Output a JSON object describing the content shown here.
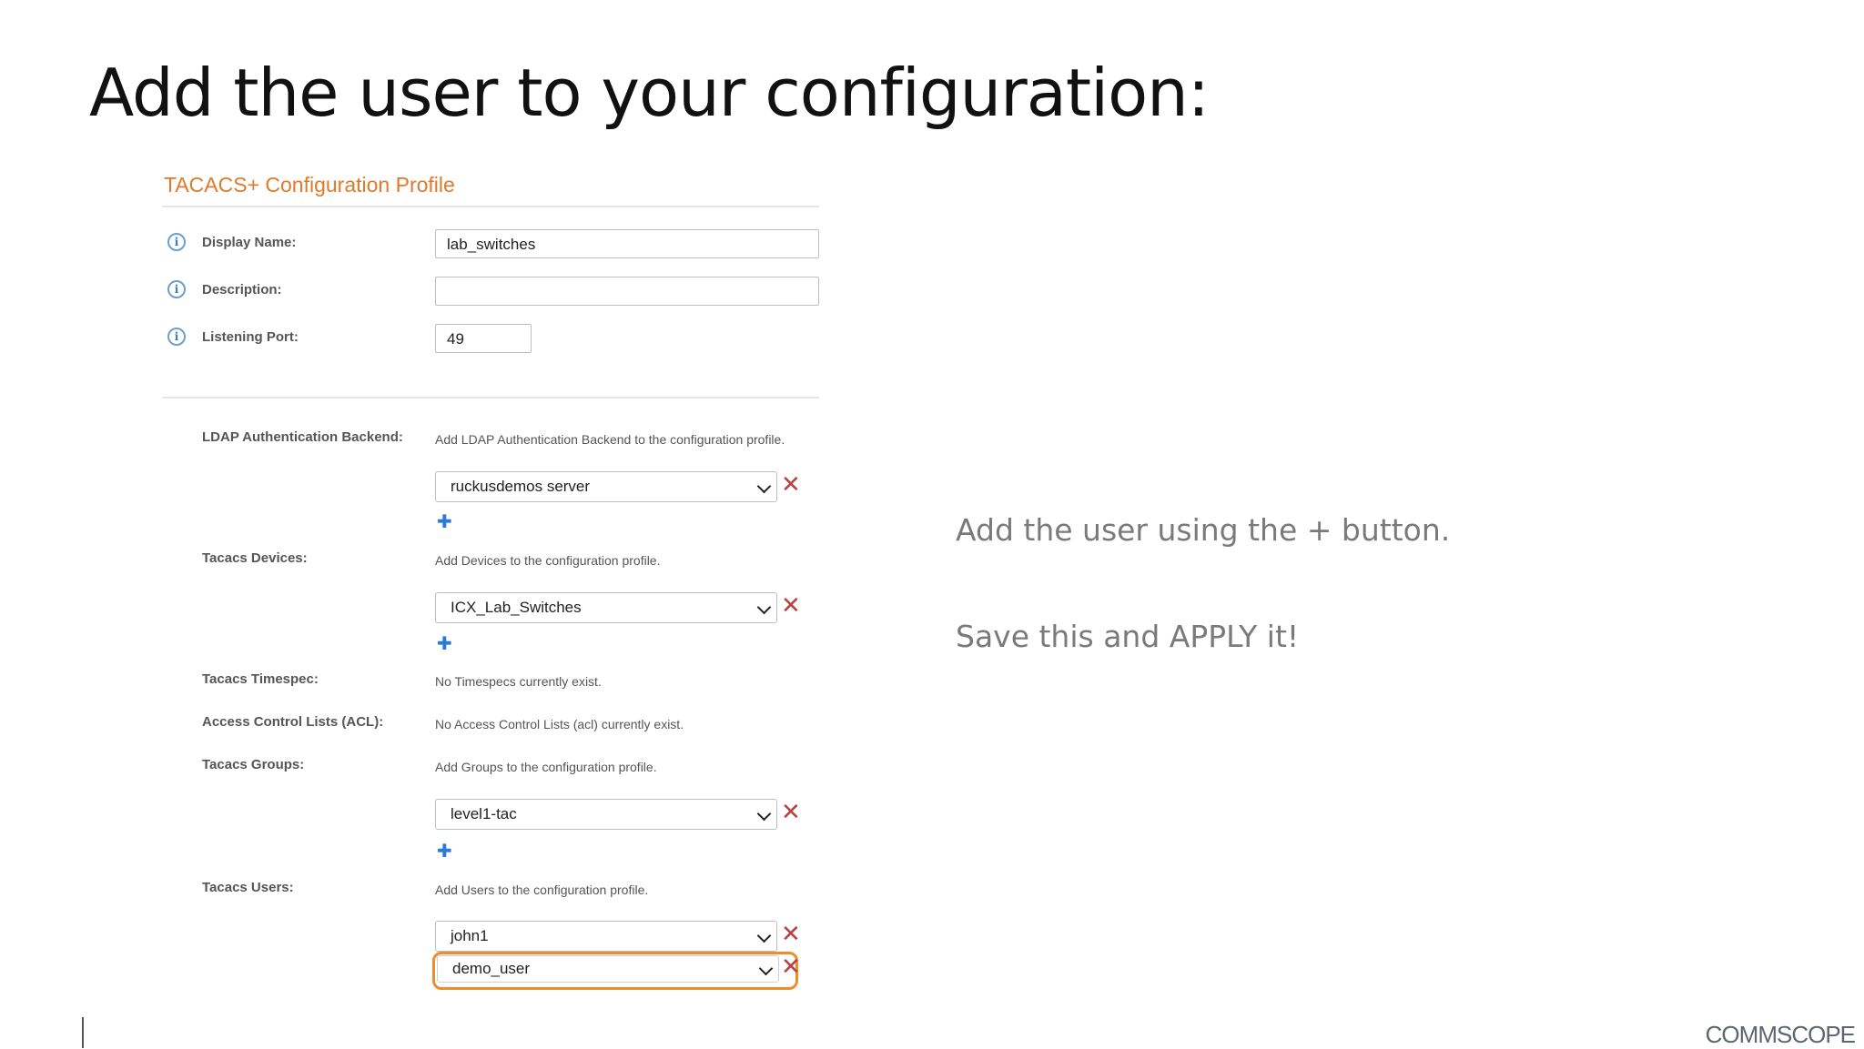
{
  "slide": {
    "title": "Add the user to your configuration:",
    "callout_1": "Add the user  using the + button.",
    "callout_2": "Save this and APPLY it!",
    "logo_text": "COMMSCOPE"
  },
  "profile": {
    "title": "TACACS+ Configuration Profile",
    "display_name": {
      "label": "Display Name:",
      "value": "lab_switches"
    },
    "description": {
      "label": "Description:",
      "value": ""
    },
    "listening_port": {
      "label": "Listening Port:",
      "value": "49"
    },
    "ldap": {
      "label": "LDAP Authentication Backend:",
      "hint": "Add LDAP Authentication Backend to the configuration profile.",
      "selected": "ruckusdemos server"
    },
    "devices": {
      "label": "Tacacs Devices:",
      "hint": "Add Devices to the configuration profile.",
      "selected": "ICX_Lab_Switches"
    },
    "timespec": {
      "label": "Tacacs Timespec:",
      "hint": "No Timespecs currently exist."
    },
    "acl": {
      "label": "Access Control Lists (ACL):",
      "hint": "No Access Control Lists (acl) currently exist."
    },
    "groups": {
      "label": "Tacacs Groups:",
      "hint": "Add Groups to the configuration profile.",
      "selected": "level1-tac"
    },
    "users": {
      "label": "Tacacs Users:",
      "hint": "Add Users to the configuration profile.",
      "selected": [
        "john1",
        "demo_user"
      ]
    }
  },
  "icons": {
    "info": "i",
    "remove": "✕",
    "add": "✚"
  },
  "colors": {
    "profile_title": "#e07a2a",
    "highlight": "#ef8a2e",
    "remove": "#b84040",
    "add": "#2a7ad6"
  }
}
